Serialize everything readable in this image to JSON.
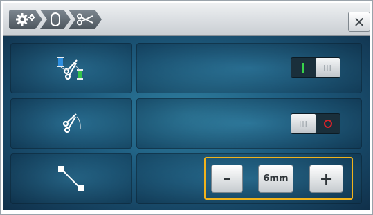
{
  "header": {
    "breadcrumb": [
      {
        "icon": "gear-icon"
      },
      {
        "icon": "spool-icon"
      },
      {
        "icon": "scissors-icon"
      }
    ],
    "close_label": "✕"
  },
  "rows": [
    {
      "icon": "thread-cut-icon",
      "toggle": {
        "state": "on",
        "knob_label": "III"
      }
    },
    {
      "icon": "scissors-cut-icon",
      "toggle": {
        "state": "off",
        "knob_label": "III"
      }
    },
    {
      "icon": "jump-stitch-icon",
      "stepper": {
        "minus_label": "–",
        "value": "6mm",
        "plus_label": "+"
      }
    }
  ],
  "colors": {
    "accent": "#f0b21b",
    "on": "#38d24b",
    "off": "#d8232a"
  }
}
